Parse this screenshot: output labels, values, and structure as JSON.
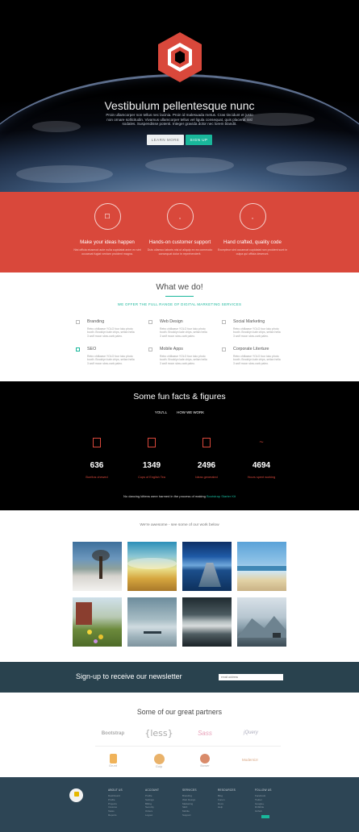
{
  "hero": {
    "title": "Vestibulum pellentesque nunc",
    "description": "Proin ullamcorper non tellus nec lacinia. Proin id malesuada metus. Cras tincidunt et justo non ornare sollicitudin. Vivamus ullamcorper tellus vel ligula consequat, quis placerat nisl sodales. Suspendisse potenti. Integer gravida dolor nec lorem blandit.",
    "learn_more": "LEARN MORE",
    "sign_up": "SIGN UP",
    "logo_color": "#d9483b"
  },
  "features": [
    {
      "icon": "lightbulb-icon",
      "glyph": "☐",
      "title": "Make your ideas happen",
      "text": "Nisi officia eiusmod aute nulla cupidatat anim ex sint occaecat fugiat veniam proident magna."
    },
    {
      "icon": "support-icon",
      "glyph": ",",
      "title": "Hands-on customer support",
      "text": "Duis ullamco laboris nisi ut aliquip ex ea commodo consequat dolor in reprehenderit."
    },
    {
      "icon": "quality-icon",
      "glyph": ",",
      "title": "Hand crafted, quality code",
      "text": "Excepteur sint occaecat cupidatat non proident sunt in culpa qui officia deserunt."
    }
  ],
  "what_we_do": {
    "title": "What we do!",
    "subtitle": "WE OFFER THE FULL RANGE OF DIGITAL MARKETING SERVICES",
    "services": [
      {
        "icon": "branding-icon",
        "title": "Branding",
        "text": "Retro chillwave YOLO four loko photo booth. Brooklyn kale chips, seitan hella 3 wolf moon slow-carb paleo."
      },
      {
        "icon": "web-design-icon",
        "title": "Web Design",
        "text": "Retro chillwave YOLO four loko photo booth. Brooklyn kale chips, seitan hella 3 wolf moon slow-carb paleo."
      },
      {
        "icon": "social-icon",
        "title": "Social Marketing",
        "text": "Retro chillwave YOLO four loko photo booth. Brooklyn kale chips, seitan hella 3 wolf moon slow-carb paleo."
      },
      {
        "icon": "seo-icon",
        "title": "SEO",
        "text": "Retro chillwave YOLO four loko photo booth. Brooklyn kale chips, seitan hella 3 wolf moon slow-carb paleo."
      },
      {
        "icon": "mobile-icon",
        "title": "Mobile Apps",
        "text": "Retro chillwave YOLO four loko photo booth. Brooklyn kale chips, seitan hella 3 wolf moon slow-carb paleo."
      },
      {
        "icon": "literature-icon",
        "title": "Corporate Literture",
        "text": "Retro chillwave YOLO four loko photo booth. Brooklyn kale chips, seitan hella 3 wolf moon slow-carb paleo."
      }
    ]
  },
  "facts": {
    "title": "Some fun facts & figures",
    "sub_left": "YOU'LL",
    "sub_right": "HOW WE WORK",
    "items": [
      {
        "icon": "hamburger-icon",
        "number": "636",
        "label": "Burritos chewed"
      },
      {
        "icon": "coffee-icon",
        "number": "1349",
        "label": "Cups of English Tea"
      },
      {
        "icon": "idea-icon",
        "number": "2496",
        "label": "Ideas generated"
      },
      {
        "icon": "clock-icon",
        "number": "4694",
        "label": "Hours spent working"
      }
    ],
    "footnote": "No dancing kittens were harmed in the process of making",
    "footnote_link": "Bootstrap Starter Kit"
  },
  "gallery": {
    "caption": "We're awesome - see some of our work below"
  },
  "newsletter": {
    "title": "Sign-up to receive our newsletter",
    "placeholder": "email address"
  },
  "partners": {
    "title": "Some of our great partners",
    "logos": [
      "Bootstrap",
      "{less}",
      "Sass",
      "jQuery",
      "Grunt",
      "Gulp",
      "Bower",
      "Modernizr"
    ]
  },
  "footer": {
    "columns": [
      {
        "title": "ABOUT US",
        "items": [
          "Dashboard",
          "Profile",
          "Projects",
          "Invoices",
          "Tasks",
          "Reports"
        ]
      },
      {
        "title": "ACCOUNT",
        "items": [
          "Profile",
          "Settings",
          "Billing",
          "Security",
          "Orders",
          "Logout"
        ]
      },
      {
        "title": "SERVICES",
        "items": [
          "Branding",
          "Web Design",
          "Marketing",
          "SEO",
          "Mobile",
          "Support"
        ]
      },
      {
        "title": "RESOURCES",
        "items": [
          "Blog",
          "Forum",
          "Docs",
          "Help"
        ]
      },
      {
        "title": "FOLLOW US",
        "items": [
          "Facebook",
          "Twitter",
          "Google+",
          "Dribbble",
          "Github"
        ]
      }
    ]
  }
}
